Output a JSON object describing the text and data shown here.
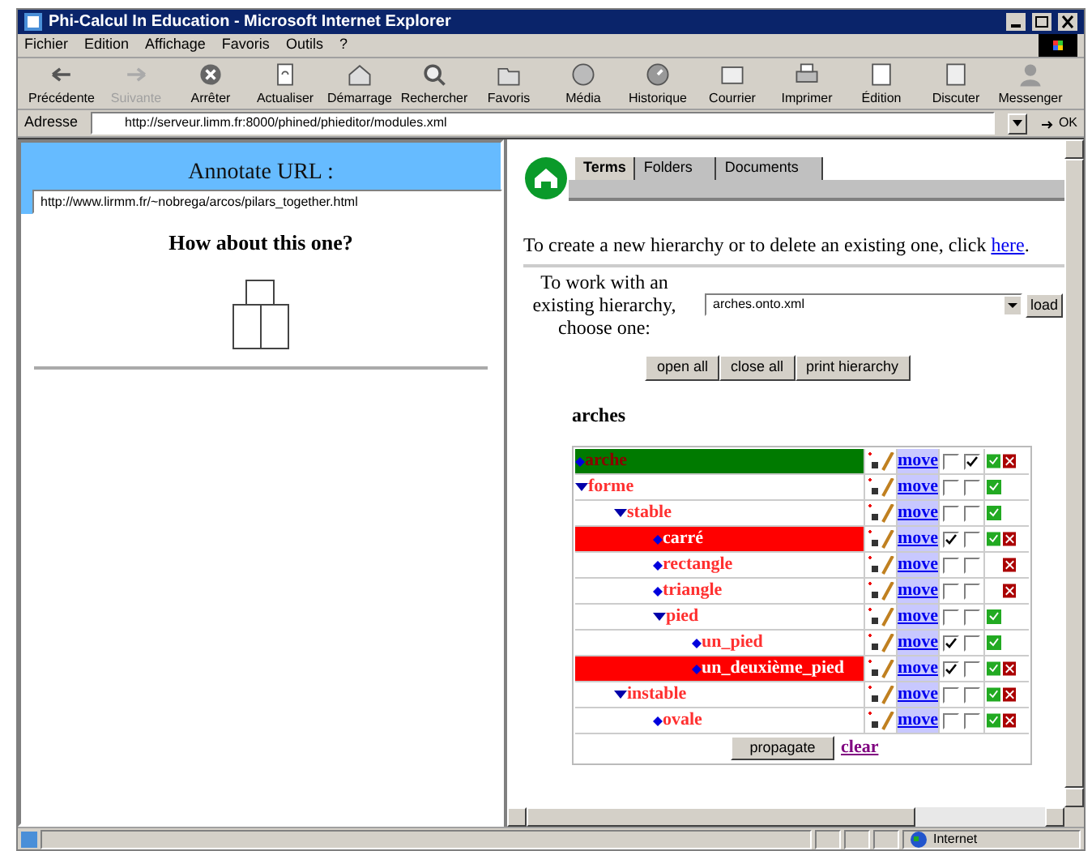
{
  "window": {
    "title": "Phi-Calcul In Education - Microsoft Internet Explorer"
  },
  "menu": [
    "Fichier",
    "Edition",
    "Affichage",
    "Favoris",
    "Outils",
    "?"
  ],
  "toolbar": [
    {
      "label": "Précédente",
      "disabled": false,
      "kind": "back"
    },
    {
      "label": "Suivante",
      "disabled": true,
      "kind": "forward"
    },
    {
      "label": "Arrêter",
      "disabled": false,
      "kind": "stop"
    },
    {
      "label": "Actualiser",
      "disabled": false,
      "kind": "refresh"
    },
    {
      "label": "Démarrage",
      "disabled": false,
      "kind": "home"
    },
    {
      "label": "Rechercher",
      "disabled": false,
      "kind": "search"
    },
    {
      "label": "Favoris",
      "disabled": false,
      "kind": "folder"
    },
    {
      "label": "Média",
      "disabled": false,
      "kind": "globe"
    },
    {
      "label": "Historique",
      "disabled": false,
      "kind": "history"
    },
    {
      "label": "Courrier",
      "disabled": false,
      "kind": "mail"
    },
    {
      "label": "Imprimer",
      "disabled": false,
      "kind": "print"
    },
    {
      "label": "Édition",
      "disabled": false,
      "kind": "edit"
    },
    {
      "label": "Discuter",
      "disabled": false,
      "kind": "discuss"
    },
    {
      "label": "Messenger",
      "disabled": false,
      "kind": "person"
    }
  ],
  "address": {
    "label": "Adresse",
    "value": "http://serveur.limm.fr:8000/phined/phieditor/modules.xml",
    "go": "OK"
  },
  "left_frame": {
    "heading": "Annotate URL :",
    "url": "http://www.lirmm.fr/~nobrega/arcos/pilars_together.html",
    "question": "How about this one?"
  },
  "right_frame": {
    "tabs": [
      {
        "label": "Terms",
        "selected": true
      },
      {
        "label": "Folders",
        "selected": false
      },
      {
        "label": "Documents",
        "selected": false
      }
    ],
    "create_text": "To create a new hierarchy or to delete an existing one, click",
    "create_link": "here",
    "create_end": ".",
    "choose_text": "To work with an existing hierarchy, choose one:",
    "hierarchy_select": "arches.onto.xml",
    "load_button": "load",
    "buttons": [
      "open all",
      "close all",
      "print hierarchy"
    ],
    "hierarchy_title": "arches",
    "tree": [
      {
        "name": "arche",
        "color": "#007a00",
        "move": "move",
        "checked_a": false,
        "checked_b": true,
        "ok": true,
        "remove": true
      },
      {
        "name": "forme",
        "color": "#ffffff",
        "move": "move",
        "checked_a": false,
        "checked_b": false,
        "ok": true,
        "remove": false,
        "children": [
          {
            "name": "stable",
            "color": "#ffffff",
            "move": "move",
            "checked_a": false,
            "checked_b": false,
            "ok": true,
            "remove": false,
            "children": [
              {
                "name": "carré",
                "color": "#ff0000",
                "move": "move",
                "checked_a": true,
                "checked_b": false,
                "ok": true,
                "remove": true
              },
              {
                "name": "rectangle",
                "color": "#ffffff",
                "move": "move",
                "checked_a": false,
                "checked_b": false,
                "ok": false,
                "remove": true
              },
              {
                "name": "triangle",
                "color": "#ffffff",
                "move": "move",
                "checked_a": false,
                "checked_b": false,
                "ok": false,
                "remove": true
              },
              {
                "name": "pied",
                "color": "#ffffff",
                "move": "move",
                "checked_a": false,
                "checked_b": false,
                "ok": true,
                "remove": false,
                "children": [
                  {
                    "name": "un_pied",
                    "color": "#ffffff",
                    "move": "move",
                    "checked_a": true,
                    "checked_b": false,
                    "ok": true,
                    "remove": false
                  },
                  {
                    "name": "un_deuxième_pied",
                    "color": "#ff0000",
                    "move": "move",
                    "checked_a": true,
                    "checked_b": false,
                    "ok": true,
                    "remove": true
                  }
                ]
              }
            ]
          },
          {
            "name": "instable",
            "color": "#ffffff",
            "move": "move",
            "checked_a": false,
            "checked_b": false,
            "ok": true,
            "remove": true,
            "children": [
              {
                "name": "ovale",
                "color": "#ffffff",
                "move": "move",
                "checked_a": false,
                "checked_b": false,
                "ok": true,
                "remove": true
              }
            ]
          }
        ]
      }
    ],
    "propagate_button": "propagate",
    "clear_link": "clear"
  },
  "status_bar": {
    "zone": "Internet"
  }
}
